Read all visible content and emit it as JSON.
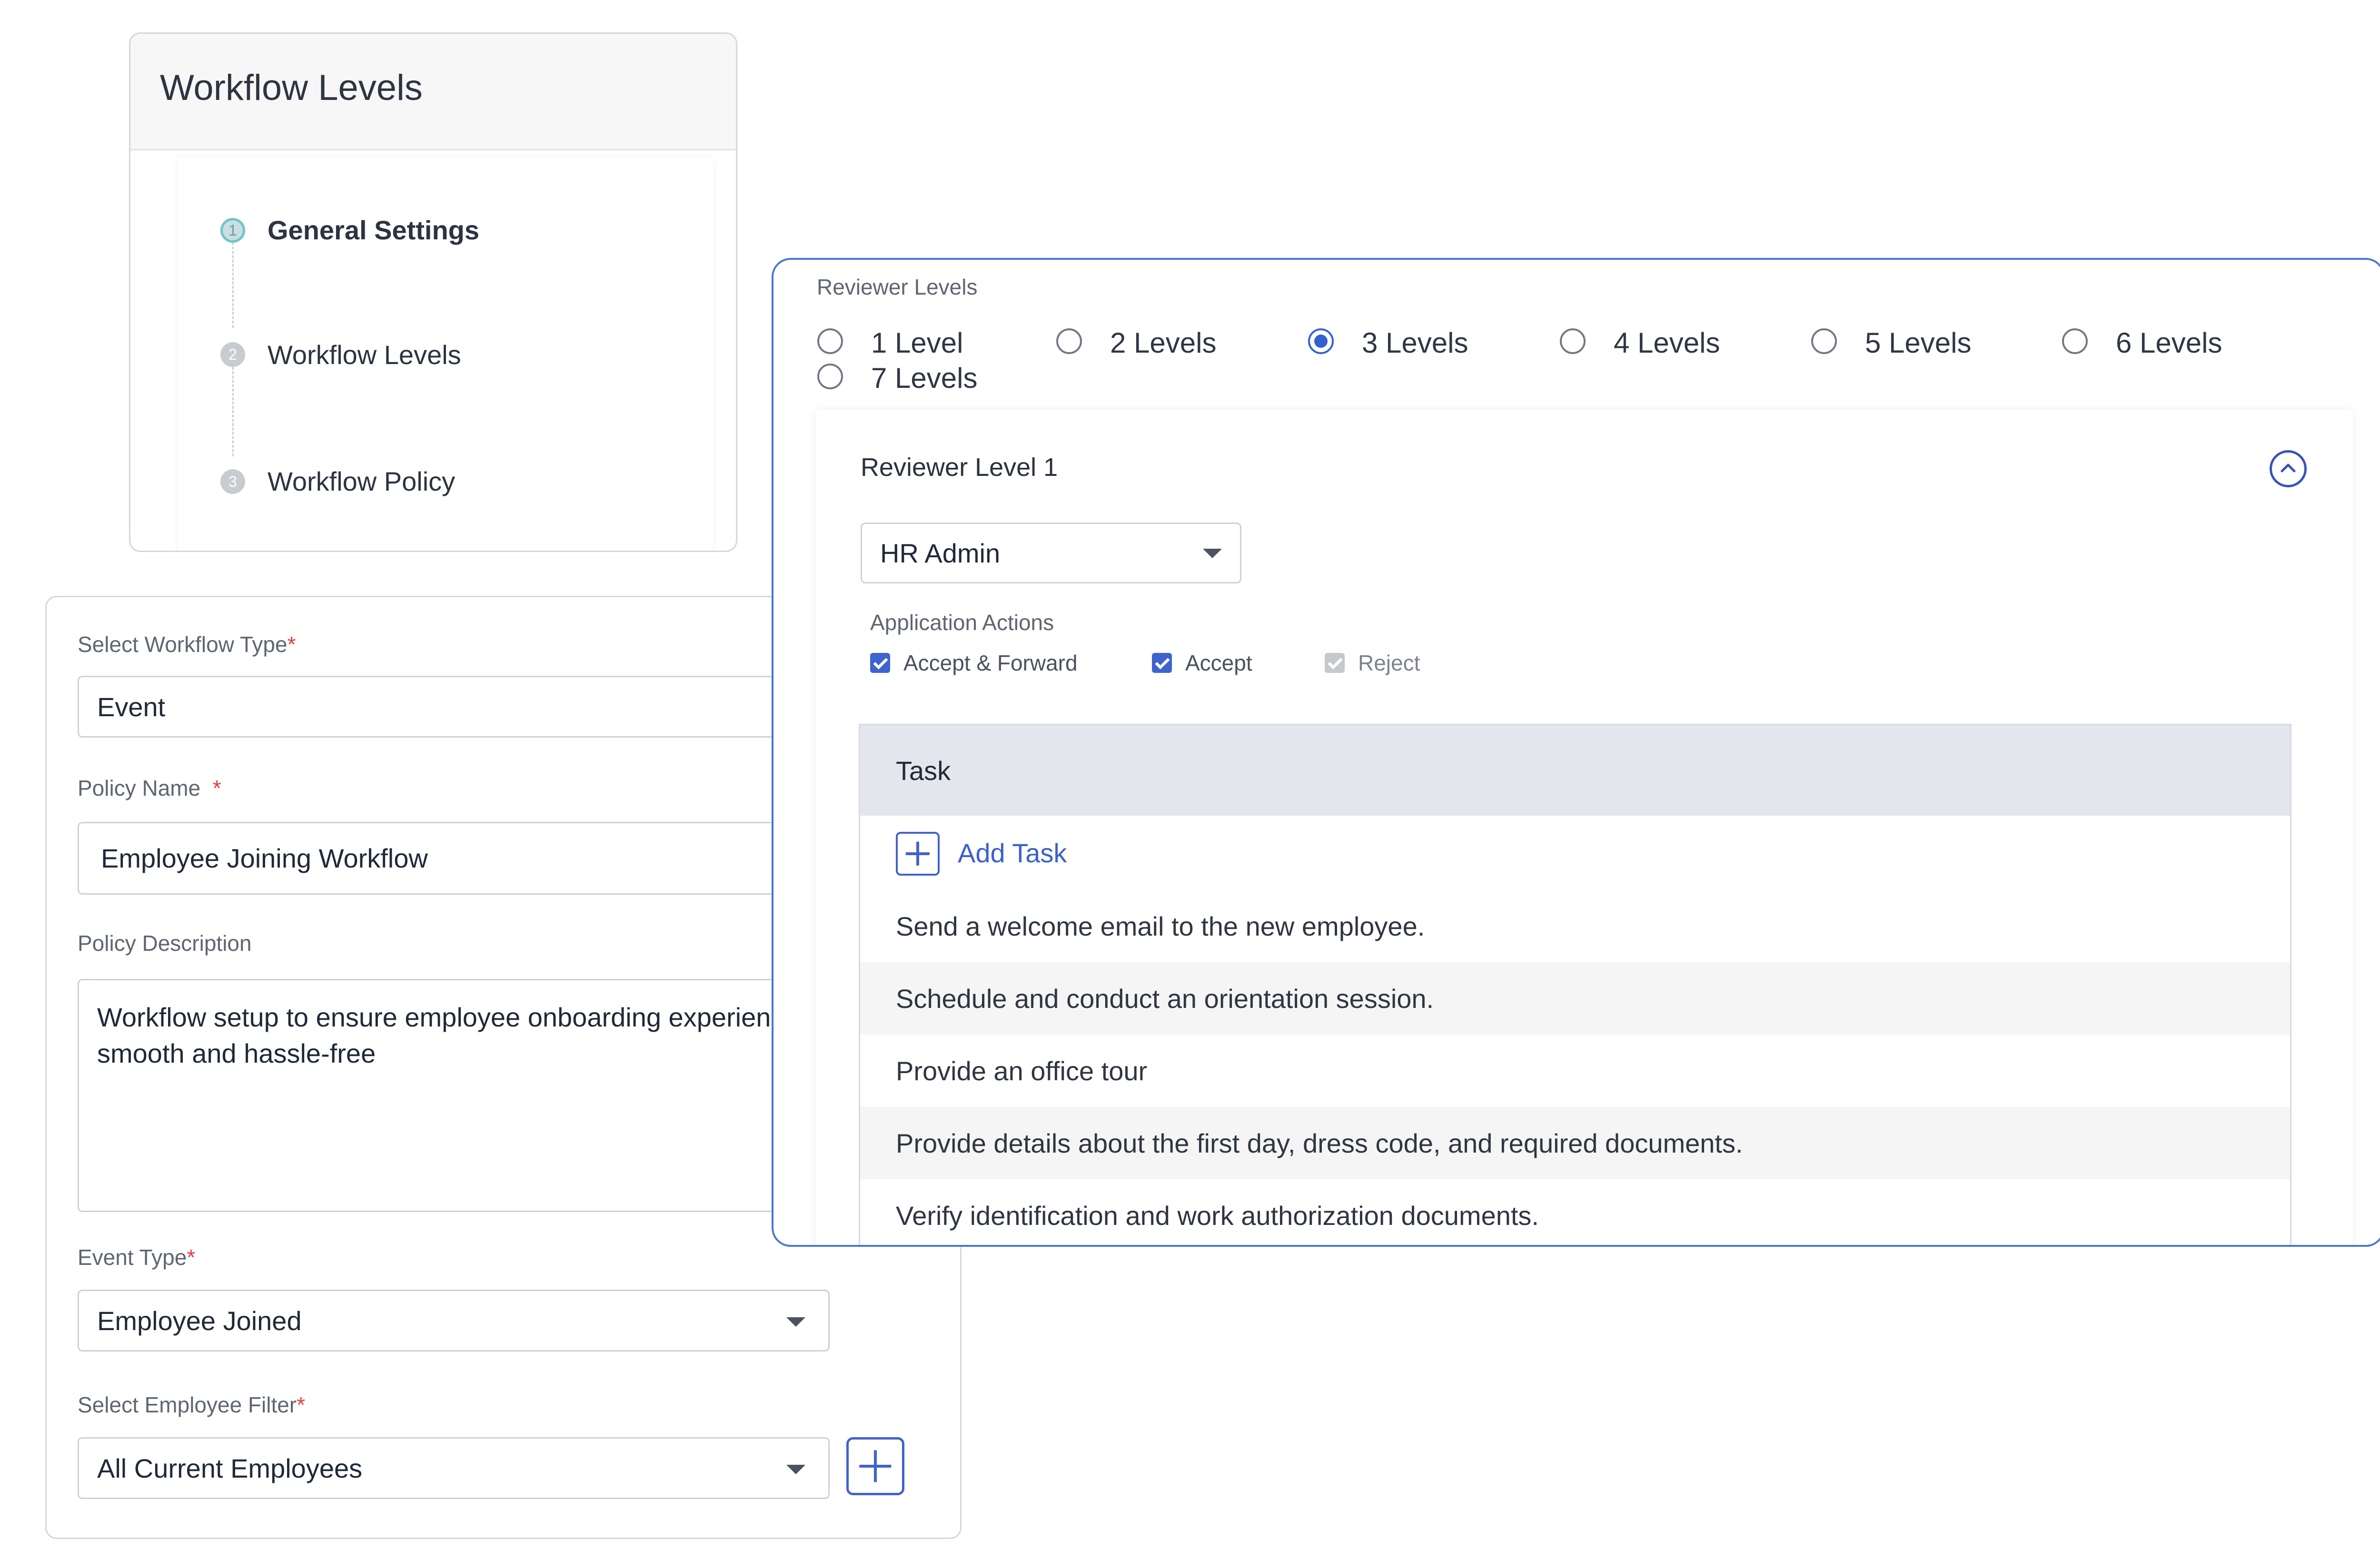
{
  "stepper": {
    "title": "Workflow Levels",
    "steps": [
      {
        "number": "1",
        "label": "General Settings",
        "state": "active"
      },
      {
        "number": "2",
        "label": "Workflow Levels",
        "state": "pending"
      },
      {
        "number": "3",
        "label": "Workflow Policy",
        "state": "pending"
      }
    ]
  },
  "form": {
    "workflow_type": {
      "label": "Select Workflow Type",
      "required_mark": "*",
      "value": "Event"
    },
    "policy_name": {
      "label": "Policy Name",
      "required_mark": "*",
      "value": "Employee Joining Workflow"
    },
    "policy_description": {
      "label": "Policy Description",
      "value_line1": "Workflow setup to ensure employee onboarding experien",
      "value_line2": "smooth and hassle-free"
    },
    "event_type": {
      "label": "Event Type",
      "required_mark": "*",
      "value": "Employee Joined"
    },
    "employee_filter": {
      "label": "Select Employee Filter",
      "required_mark": "*",
      "value": "All Current Employees"
    },
    "add_filter_icon": "plus-icon"
  },
  "reviewer": {
    "levels_label": "Reviewer Levels",
    "options": [
      {
        "label": "1 Level",
        "checked": false
      },
      {
        "label": "2 Levels",
        "checked": false
      },
      {
        "label": "3 Levels",
        "checked": true
      },
      {
        "label": "4 Levels",
        "checked": false
      },
      {
        "label": "5 Levels",
        "checked": false
      },
      {
        "label": "6 Levels",
        "checked": false
      },
      {
        "label": "7 Levels",
        "checked": false
      }
    ],
    "level_panel": {
      "title": "Reviewer Level 1",
      "collapse_icon": "chevron-up-icon",
      "reviewer_select": "HR Admin",
      "actions_label": "Application Actions",
      "actions": [
        {
          "label": "Accept & Forward",
          "checked": true,
          "disabled": false
        },
        {
          "label": "Accept",
          "checked": true,
          "disabled": false
        },
        {
          "label": "Reject",
          "checked": true,
          "disabled": true
        }
      ],
      "task_header": "Task",
      "add_task_label": "Add Task",
      "tasks": [
        "Send a welcome email to the new employee.",
        "Schedule and conduct an orientation session.",
        "Provide an office tour",
        "Provide details about the first day, dress code, and required documents.",
        "Verify identification and work authorization documents."
      ]
    }
  },
  "colors": {
    "accent": "#3461d1",
    "active_step_ring": "#70c2cf",
    "required": "#e53e3e",
    "task_header_bg": "#e3e7ed"
  }
}
